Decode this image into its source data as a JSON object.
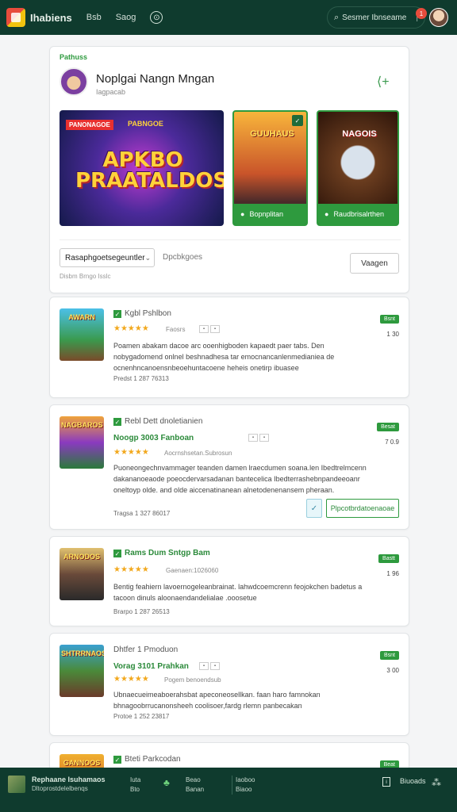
{
  "topbar": {
    "brand": "Ihabiens",
    "nav": [
      "Bsb",
      "Saog"
    ],
    "search": "Sesmer Ibnseame",
    "badge": "1"
  },
  "header": {
    "label": "Pathuss",
    "title": "Noplgai Nangn Mngan",
    "subtitle": "Iagpacab",
    "banner": {
      "tag": "PANONAGOE",
      "tag2": "PABNGOE",
      "art_text": "APKBO PRAATALDOS"
    },
    "tiles": [
      {
        "art_text": "GUUHAUS",
        "footer": "Bopnplitan"
      },
      {
        "art_text": "NAGOIS",
        "footer": "Raudbrisalrthen"
      }
    ],
    "select": "Rasaphgoetsegeuntler",
    "filter_label": "Dpcbkgoes",
    "button": "Vaagen",
    "result_count": "Disbm Brngo Isslc"
  },
  "items": [
    {
      "thumb_text": "AWARN",
      "name": "Kgbl Pshlbon",
      "stars": "★★★★★",
      "sub": "Faosrs",
      "desc": "Poamen abakam dacoe arc ooenhigboden kapaedt paer tabs. Den nobygadomend onlnel beshnadhesa tar emocnancanlenmedianiea de ocnenhncanoensnbeoehuntacoene heheis onetirp ibuasee",
      "meta": "Predst 1 287 76313",
      "badge": "Bsnt",
      "num": "1 30"
    },
    {
      "thumb_text": "NAGBAROS",
      "name": "Rebl Dett dnoletianien",
      "name2": "Noogp 3003 Fanboan",
      "stars": "★★★★★",
      "sub": "Aocrnshsetan.Subrosun",
      "desc": "Puoneongechnvammager teanden damen lraecdumen soana.len Ibedtrelmcenn dakananoeaode poeocdervarsadanan bantecelica Ibedterrashebnpandeeoanr oneltoyp olde. and olde aiccenatinanean alnetodenenansem pheraan.",
      "meta": "Tragsa 1 327 86017",
      "badge": "Besat",
      "num": "7 0.9",
      "action": "Plpcotbrdatoenaoae"
    },
    {
      "thumb_text": "ARNODOS",
      "name": "Rams Dum Sntgp Bam",
      "stars": "★★★★★",
      "sub": "Gaenaen:1026060",
      "desc": "Bentig feahiern lavoernogeleanbrainat. lahwdcoemcrenn feojokchen badetus a tacoon dinuls aloonaendandelialae .ooosetue",
      "meta": "Brarpo 1 287 26513",
      "badge": "Bastt",
      "num": "1 96"
    },
    {
      "thumb_text": "SHTRRNAOS",
      "name": "Dhtfer 1 Pmoduon",
      "name2": "Vorag 3101 Prahkan",
      "stars": "★★★★★",
      "sub": "Pogem benoendsub",
      "desc": "Ubnaecueimeaboerahsbat apeconeosellkan. faan haro famnokan bhnagoobrrucanonsheeh coolisoer,fardg rlemn panbecakan",
      "meta": "Protoe 1 252 23817",
      "badge": "Bsnt",
      "num": "3 00"
    },
    {
      "thumb_text": "GANNOOS",
      "name": "Bteti Parkcodan",
      "badge": "Beat"
    }
  ],
  "bottombar": {
    "title": "Rephaane Isuhamaos",
    "sub": "Dltoprostdelelbenqs",
    "cols": [
      [
        "Iuta",
        "Bto"
      ],
      [
        "Beao",
        "Banan"
      ],
      [
        "Iaoboo",
        "Biaoo"
      ]
    ],
    "right": "Biuoads"
  }
}
